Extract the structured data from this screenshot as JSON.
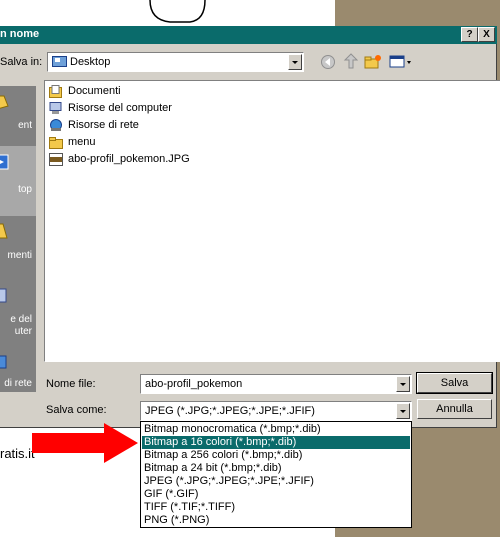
{
  "window": {
    "title": "n nome",
    "help_label": "?",
    "close_label": "X"
  },
  "save_in": {
    "label": "Salva in:",
    "value": "Desktop"
  },
  "places": [
    {
      "label": "ent",
      "icon": "recent-documents-icon"
    },
    {
      "label": "top",
      "icon": "desktop-icon"
    },
    {
      "label": "menti",
      "icon": "my-documents-icon"
    },
    {
      "label": "e del\nuter",
      "icon": "my-computer-icon"
    },
    {
      "label": "di rete",
      "icon": "network-places-icon"
    }
  ],
  "files": [
    {
      "name": "Documenti",
      "icon": "documents-folder-icon"
    },
    {
      "name": "Risorse del computer",
      "icon": "my-computer-icon"
    },
    {
      "name": "Risorse di rete",
      "icon": "network-places-icon"
    },
    {
      "name": "menu",
      "icon": "folder-icon"
    },
    {
      "name": "abo-profil_pokemon.JPG",
      "icon": "jpg-file-icon"
    }
  ],
  "filename": {
    "label": "Nome file:",
    "value": "abo-profil_pokemon"
  },
  "filetype": {
    "label": "Salva come:",
    "value": "JPEG (*.JPG;*.JPEG;*.JPE;*.JFIF)",
    "options": [
      "Bitmap monocromatica (*.bmp;*.dib)",
      "Bitmap a 16 colori (*.bmp;*.dib)",
      "Bitmap a 256 colori (*.bmp;*.dib)",
      "Bitmap a 24 bit (*.bmp;*.dib)",
      "JPEG (*.JPG;*.JPEG;*.JPE;*.JFIF)",
      "GIF (*.GIF)",
      "TIFF (*.TIF;*.TIFF)",
      "PNG (*.PNG)"
    ],
    "selected_index": 1
  },
  "buttons": {
    "save": "Salva",
    "cancel": "Annulla"
  },
  "background_text": "ratis.it",
  "colors": {
    "selection": "#0a6b6b",
    "arrow": "#ff0000",
    "dialog_bg": "#d4d0c8"
  }
}
